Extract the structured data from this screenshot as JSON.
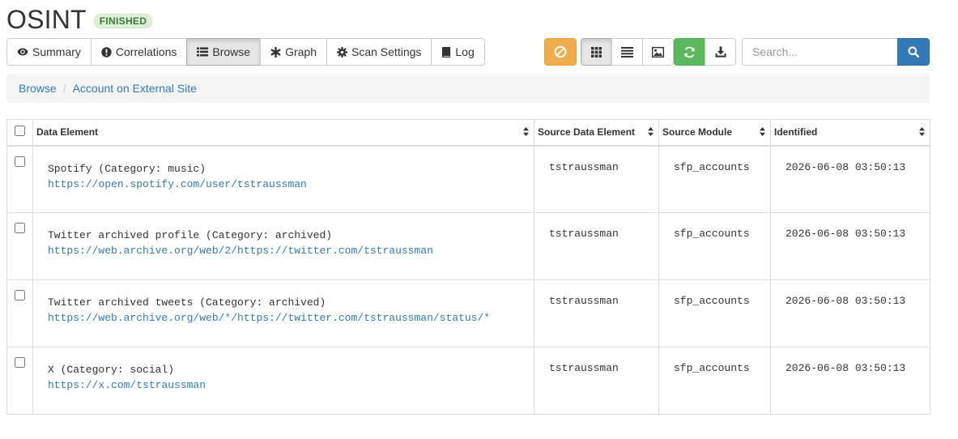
{
  "header": {
    "title": "OSINT",
    "status": "FINISHED"
  },
  "tabs": [
    {
      "label": "Summary",
      "icon": "eye-icon"
    },
    {
      "label": "Correlations",
      "icon": "exclamation-circle-icon"
    },
    {
      "label": "Browse",
      "icon": "list-icon",
      "active": true
    },
    {
      "label": "Graph",
      "icon": "asterisk-icon"
    },
    {
      "label": "Scan Settings",
      "icon": "cog-icon"
    },
    {
      "label": "Log",
      "icon": "book-icon"
    }
  ],
  "toolbar": {
    "stop_icon": "ban-icon",
    "view_icons": [
      "grid-icon",
      "list-view-icon",
      "image-icon"
    ],
    "refresh_icon": "refresh-icon",
    "download_icon": "download-icon"
  },
  "search": {
    "placeholder": "Search...",
    "value": ""
  },
  "breadcrumb": [
    "Browse",
    "Account on External Site"
  ],
  "table": {
    "columns": [
      "Data Element",
      "Source Data Element",
      "Source Module",
      "Identified"
    ],
    "rows": [
      {
        "element": "Spotify (Category: music)",
        "url": "https://open.spotify.com/user/tstraussman",
        "source_element": "tstraussman",
        "module": "sfp_accounts",
        "identified": "2026-06-08 03:50:13"
      },
      {
        "element": "Twitter archived profile (Category: archived)",
        "url": "https://web.archive.org/web/2/https://twitter.com/tstraussman",
        "source_element": "tstraussman",
        "module": "sfp_accounts",
        "identified": "2026-06-08 03:50:13"
      },
      {
        "element": "Twitter archived tweets (Category: archived)",
        "url": "https://web.archive.org/web/*/https://twitter.com/tstraussman/status/*",
        "source_element": "tstraussman",
        "module": "sfp_accounts",
        "identified": "2026-06-08 03:50:13"
      },
      {
        "element": "X (Category: social)",
        "url": "https://x.com/tstraussman",
        "source_element": "tstraussman",
        "module": "sfp_accounts",
        "identified": "2026-06-08 03:50:13"
      }
    ]
  },
  "colors": {
    "link": "#337ab7",
    "warning": "#f0ad4e",
    "success": "#5cb85c",
    "primary": "#337ab7",
    "badge_bg": "#dff0d8",
    "badge_text": "#3c763d"
  }
}
